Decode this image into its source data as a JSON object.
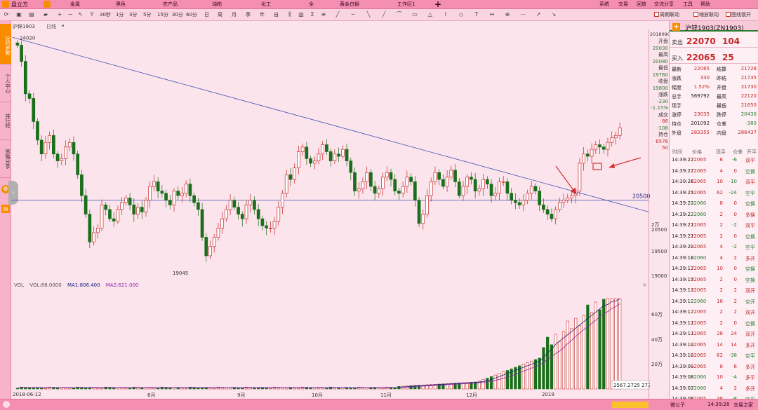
{
  "app": {
    "name": "盘立方"
  },
  "menu": [
    "金属",
    "黑色",
    "农产品",
    "油粕",
    "化工",
    "全",
    "黄金白银",
    "工作区1"
  ],
  "menu_right": [
    "系统",
    "交易",
    "回放",
    "交流分享",
    "工具",
    "帮助"
  ],
  "toolbar": {
    "periods": [
      "30秒",
      "1分",
      "3分",
      "5分",
      "15分",
      "30分",
      "60分",
      "日",
      "周",
      "月",
      "季",
      "年"
    ],
    "custom": "自",
    "options": [
      "周期联动",
      "缩放联动",
      "图线锁开"
    ]
  },
  "sidebar": [
    "分时走势",
    "个人中心",
    "排行榜",
    "策略分享"
  ],
  "chart": {
    "symbol": "沪锌1903",
    "period": "日线",
    "date_label": "20180907",
    "high_marker": "24020",
    "low_marker": "19045",
    "hline_label": "20500",
    "price_ticks": [
      "2万",
      "20500",
      "19500",
      "19000"
    ],
    "vol_ticks": [
      "60万",
      "40万",
      "20万"
    ],
    "vol_header": {
      "name": "VOL",
      "vol": "VOL:88.0000",
      "ma1": "MA1:806.400",
      "ma2": "MA2:621.000"
    },
    "vol_readout": "2567.2725 2726",
    "dates": [
      "2018-06-12",
      "8月",
      "9月",
      "10月",
      "11月",
      "12月",
      "2019"
    ]
  },
  "scale_info": [
    {
      "label": "开盘",
      "value": "20030"
    },
    {
      "label": "最高",
      "value": "20080"
    },
    {
      "label": "最低",
      "value": "19760"
    },
    {
      "label": "收盘",
      "value": "19800"
    },
    {
      "label": "涨跌",
      "value": "-230"
    },
    {
      "label": "",
      "value": "-1.15%"
    },
    {
      "label": "成交",
      "value": "86"
    },
    {
      "label": "",
      "value": "-108"
    },
    {
      "label": "持仓",
      "value": "6576"
    },
    {
      "label": "",
      "value": "50"
    }
  ],
  "quote": {
    "title": "沪锌1903(ZN1903)",
    "sell": {
      "label": "卖出",
      "price": "22070",
      "vol": "104"
    },
    "buy": {
      "label": "买入",
      "price": "22065",
      "vol": "25"
    },
    "rows": [
      [
        [
          "最新",
          "22065"
        ],
        [
          "结算",
          "21728"
        ]
      ],
      [
        [
          "涨跌",
          "330"
        ],
        [
          "昨结",
          "21735"
        ]
      ],
      [
        [
          "幅度",
          "1.52%"
        ],
        [
          "开盘",
          "21730"
        ]
      ],
      [
        [
          "总手",
          "569792"
        ],
        [
          "最高",
          "22120"
        ]
      ],
      [
        [
          "现手",
          ""
        ],
        [
          "最低",
          "21650"
        ]
      ],
      [
        [
          "涨停",
          "23035"
        ],
        [
          "跌停",
          "20430"
        ]
      ],
      [
        [
          "持仓",
          "201092"
        ],
        [
          "仓差",
          "-380"
        ]
      ],
      [
        [
          "外盘",
          "283355"
        ],
        [
          "内盘",
          "286437"
        ]
      ]
    ],
    "tick_header": [
      "时间",
      "价格",
      "现手",
      "仓差",
      "开平"
    ],
    "ticks": [
      [
        "14:39:27",
        "22065",
        "6",
        "-6",
        "双平"
      ],
      [
        "14:39:27",
        "22065",
        "4",
        "0",
        "空换"
      ],
      [
        "14:39:26",
        "22065",
        "10",
        "-10",
        "双平"
      ],
      [
        "14:39:25",
        "22065",
        "62",
        "-24",
        "空平"
      ],
      [
        "14:39:23",
        "22060",
        "8",
        "0",
        "空换"
      ],
      [
        "14:39:22",
        "22060",
        "2",
        "0",
        "多换"
      ],
      [
        "14:39:21",
        "22065",
        "2",
        "-2",
        "双平"
      ],
      [
        "14:39:21",
        "22065",
        "2",
        "0",
        "空换"
      ],
      [
        "14:39:20",
        "22065",
        "4",
        "-2",
        "空平"
      ],
      [
        "14:39:18",
        "22060",
        "4",
        "2",
        "多开"
      ],
      [
        "14:39:17",
        "22065",
        "10",
        "0",
        "空换"
      ],
      [
        "14:39:15",
        "22065",
        "2",
        "0",
        "空换"
      ],
      [
        "14:39:13",
        "22065",
        "2",
        "2",
        "双开"
      ],
      [
        "14:39:12",
        "22060",
        "16",
        "2",
        "空开"
      ],
      [
        "14:39:12",
        "22065",
        "2",
        "2",
        "双开"
      ],
      [
        "14:39:11",
        "22065",
        "2",
        "0",
        "空换"
      ],
      [
        "14:39:11",
        "22065",
        "28",
        "24",
        "双开"
      ],
      [
        "14:39:10",
        "22065",
        "14",
        "14",
        "多开"
      ],
      [
        "14:39:10",
        "22065",
        "62",
        "-38",
        "空平"
      ],
      [
        "14:39:09",
        "22065",
        "8",
        "6",
        "多开"
      ],
      [
        "14:39:08",
        "22060",
        "10",
        "-4",
        "多平"
      ],
      [
        "14:39:07",
        "22060",
        "4",
        "2",
        "多开"
      ],
      [
        "14:39:06",
        "22065",
        "38",
        "-8",
        "空平"
      ]
    ]
  },
  "status": {
    "user": "微公子",
    "time": "14:39:28",
    "account": "交易之家"
  },
  "colors": {
    "up": "#c62828",
    "down": "#1b6e1b",
    "trend": "#3f51b5",
    "hline": "#3f51b5",
    "bg": "#fce4ec"
  }
}
